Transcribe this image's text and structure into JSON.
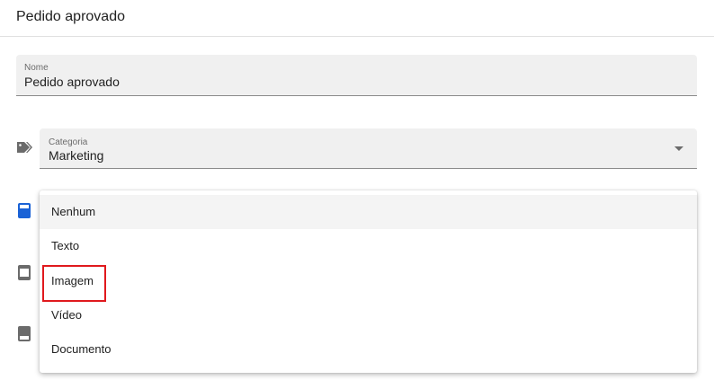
{
  "header": {
    "title": "Pedido aprovado"
  },
  "name_field": {
    "label": "Nome",
    "value": "Pedido aprovado"
  },
  "category_field": {
    "label": "Categoria",
    "value": "Marketing",
    "icon": "tag-icon"
  },
  "side_icons": [
    "header-format-icon",
    "image-format-icon",
    "document-format-icon"
  ],
  "menu": {
    "items": [
      {
        "label": "Nenhum",
        "selected": true
      },
      {
        "label": "Texto",
        "selected": false
      },
      {
        "label": "Imagem",
        "selected": false,
        "highlighted": true
      },
      {
        "label": "Vídeo",
        "selected": false
      },
      {
        "label": "Documento",
        "selected": false
      }
    ]
  },
  "colors": {
    "accent": "#1a62d6",
    "highlight_border": "#e0191d",
    "field_bg": "#f0f0f0"
  }
}
